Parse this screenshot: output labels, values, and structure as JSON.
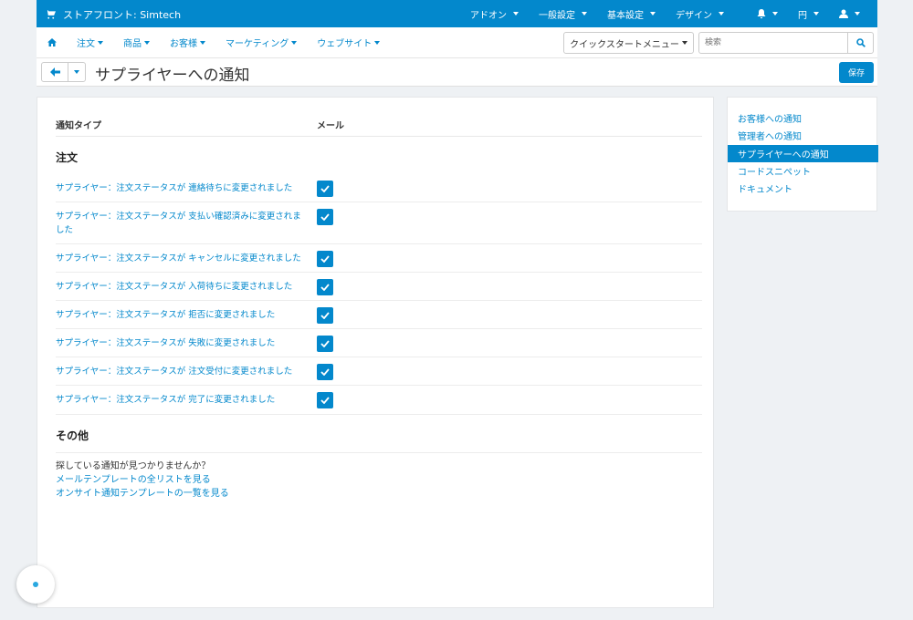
{
  "topbar": {
    "store_name": "ストアフロント: Simtech",
    "menu": [
      "アドオン",
      "一般設定",
      "基本設定",
      "デザイン"
    ],
    "currency": "円"
  },
  "nav": {
    "items": [
      "注文",
      "商品",
      "お客様",
      "マーケティング",
      "ウェブサイト"
    ],
    "quickstart": "クイックスタートメニュー",
    "search_placeholder": "検索"
  },
  "page": {
    "title": "サプライヤーへの通知",
    "save_label": "保存"
  },
  "table": {
    "col_type": "通知タイプ",
    "col_email": "メール",
    "section_orders": "注文",
    "rows": [
      {
        "label": "サプライヤー：注文ステータスが 連絡待ちに変更されました",
        "checked": true
      },
      {
        "label": "サプライヤー：注文ステータスが 支払い確認済みに変更されま",
        "label2": "した",
        "checked": true
      },
      {
        "label": "サプライヤー：注文ステータスが キャンセルに変更されました",
        "checked": true
      },
      {
        "label": "サプライヤー：注文ステータスが 入荷待ちに変更されました",
        "checked": true
      },
      {
        "label": "サプライヤー：注文ステータスが 拒否に変更されました",
        "checked": true
      },
      {
        "label": "サプライヤー：注文ステータスが 失敗に変更されました",
        "checked": true
      },
      {
        "label": "サプライヤー：注文ステータスが 注文受付に変更されました",
        "checked": true
      },
      {
        "label": "サプライヤー：注文ステータスが 完了に変更されました",
        "checked": true
      }
    ],
    "section_other": "その他"
  },
  "footer": {
    "question": "探している通知が見つかりませんか？",
    "link1": "メールテンプレートの全リストを見る",
    "link2": "オンサイト通知テンプレートの一覧を見る"
  },
  "sidebar": {
    "items": [
      {
        "label": "お客様への通知",
        "active": false
      },
      {
        "label": "管理者への通知",
        "active": false
      },
      {
        "label": "サプライヤーへの通知",
        "active": true
      },
      {
        "label": "コードスニペット",
        "active": false
      },
      {
        "label": "ドキュメント",
        "active": false
      }
    ]
  },
  "colors": {
    "accent": "#0388cc",
    "background": "#eef1f4"
  }
}
